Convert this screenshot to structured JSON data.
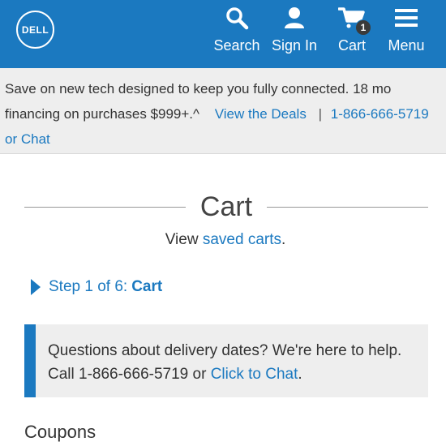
{
  "header": {
    "logo": "DELL",
    "nav": {
      "search": "Search",
      "signin": "Sign In",
      "cart": "Cart",
      "cart_count": "1",
      "menu": "Menu"
    }
  },
  "promo": {
    "text": "Save on new tech designed to keep you fully connected. 18 mo financing on purchases $999+.^",
    "deals_link": "View the Deals",
    "separator": "|",
    "phone": "1-866-666-5719",
    "chat_connector": "or",
    "chat": "Chat"
  },
  "page": {
    "title": "Cart",
    "saved_prefix": "View ",
    "saved_link": "saved carts",
    "saved_suffix": "."
  },
  "step": {
    "prefix": "Step 1 of 6:",
    "current": "Cart"
  },
  "notice": {
    "text": "Questions about delivery dates? We're here to help. Call 1-866-666-5719 or ",
    "link": "Click to Chat",
    "suffix": "."
  },
  "coupons": {
    "heading": "Coupons"
  },
  "colors": {
    "brand": "#1b79c0",
    "promo_bg": "#eeeeee",
    "text": "#333333"
  }
}
